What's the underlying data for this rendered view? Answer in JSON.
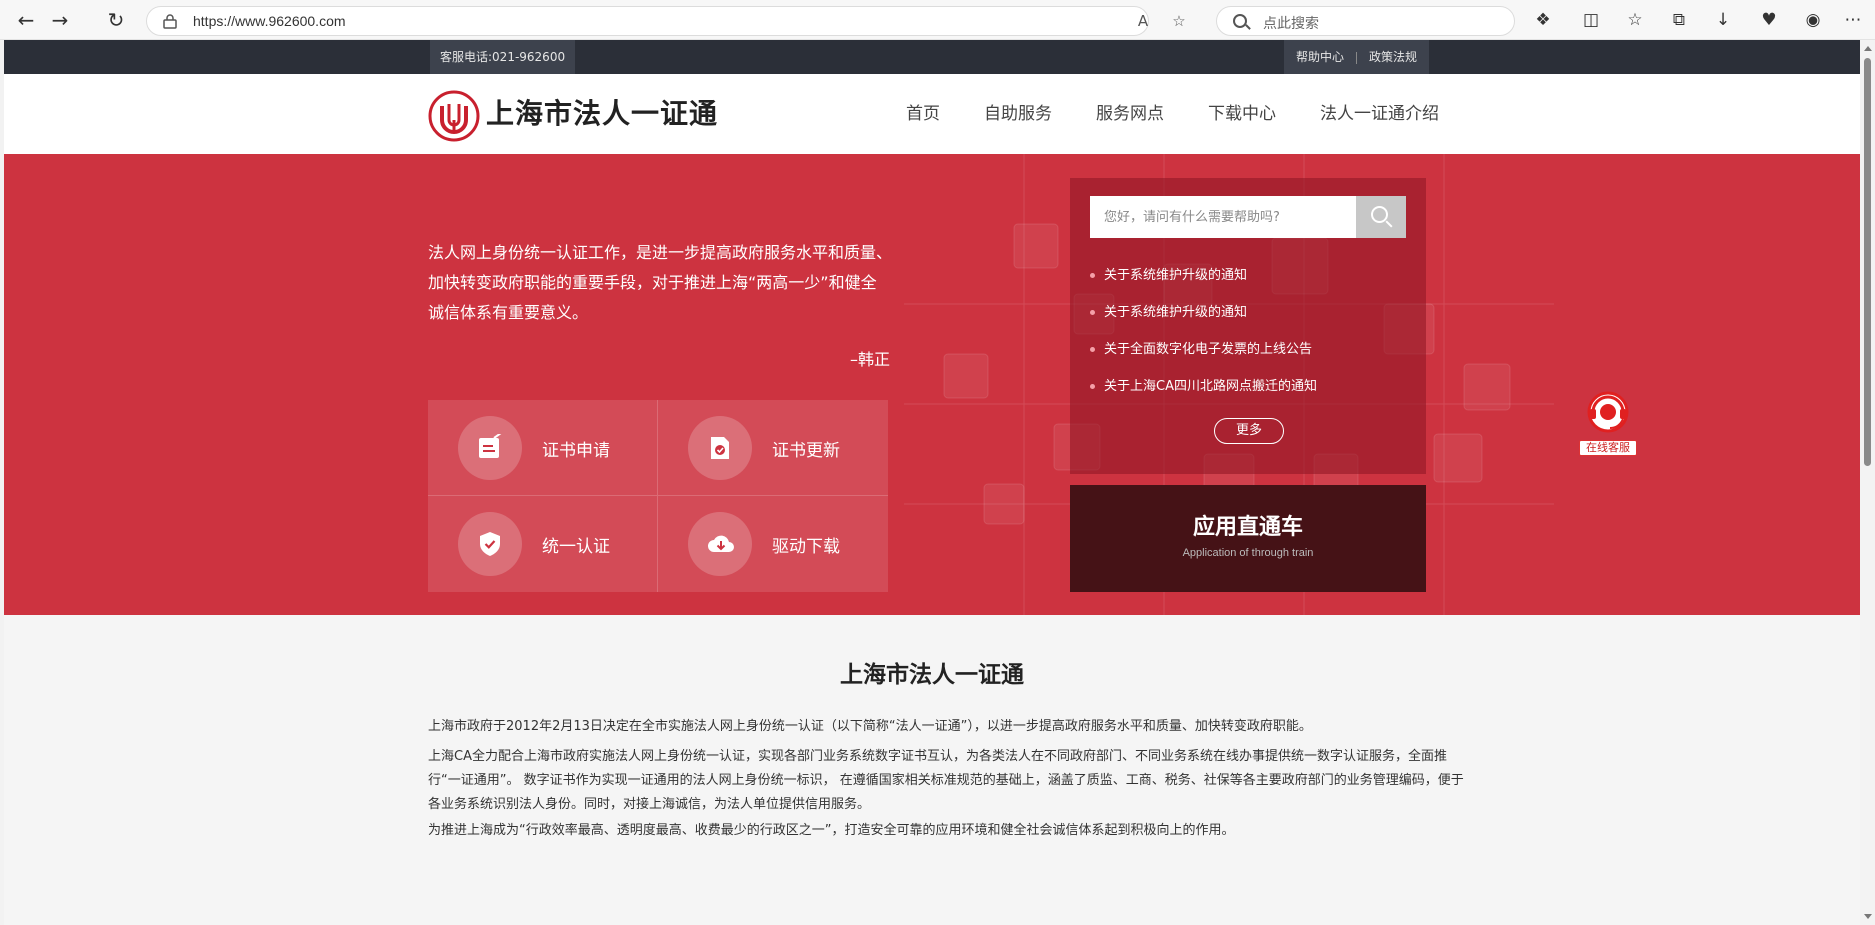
{
  "browser": {
    "url": "https://www.962600.com",
    "search_placeholder": "点此搜索"
  },
  "top_bar": {
    "hotline": "客服电话:021-962600",
    "links": [
      "帮助中心",
      "政策法规"
    ]
  },
  "header": {
    "brand": "上海市法人一证通",
    "nav": [
      "首页",
      "自助服务",
      "服务网点",
      "下载中心",
      "法人一证通介绍"
    ]
  },
  "hero": {
    "quote": "法人网上身份统一认证工作，是进一步提高政府服务水平和质量、加快转变政府职能的重要手段，对于推进上海“两高一少”和健全诚信体系有重要意义。",
    "author": "–韩正",
    "services": [
      {
        "label": "证书申请",
        "icon": "certificate-apply-icon"
      },
      {
        "label": "证书更新",
        "icon": "certificate-update-icon"
      },
      {
        "label": "统一认证",
        "icon": "shield-check-icon"
      },
      {
        "label": "驱动下载",
        "icon": "cloud-download-icon"
      }
    ]
  },
  "news": {
    "search_placeholder": "您好，请问有什么需要帮助吗?",
    "items": [
      "关于系统维护升级的通知",
      "关于系统维护升级的通知",
      "关于全面数字化电子发票的上线公告",
      "关于上海CA四川北路网点搬迁的通知"
    ],
    "more": "更多"
  },
  "app_entry": {
    "title": "应用直通车",
    "subtitle": "Application of through train"
  },
  "customer_service": {
    "label": "在线客服"
  },
  "intro": {
    "title": "上海市法人一证通",
    "paragraphs": [
      "上海市政府于2012年2月13日决定在全市实施法人网上身份统一认证（以下简称“法人一证通”），以进一步提高政府服务水平和质量、加快转变政府职能。",
      "上海CA全力配合上海市政府实施法人网上身份统一认证，实现各部门业务系统数字证书互认，为各类法人在不同政府部门、不同业务系统在线办事提供统一数字认证服务，全面推行“一证通用”。 数字证书作为实现一证通用的法人网上身份统一标识， 在遵循国家相关标准规范的基础上，涵盖了质监、工商、税务、社保等各主要政府部门的业务管理编码，便于各业务系统识别法人身份。同时，对接上海诚信，为法人单位提供信用服务。",
      "为推进上海成为“行政效率最高、透明度最高、收费最少的行政区之一”，打造安全可靠的应用环境和健全社会诚信体系起到积极向上的作用。"
    ]
  },
  "colors": {
    "hero_red": "#cd3340",
    "dark_strip": "#2b2f38",
    "app_box": "#451216"
  }
}
